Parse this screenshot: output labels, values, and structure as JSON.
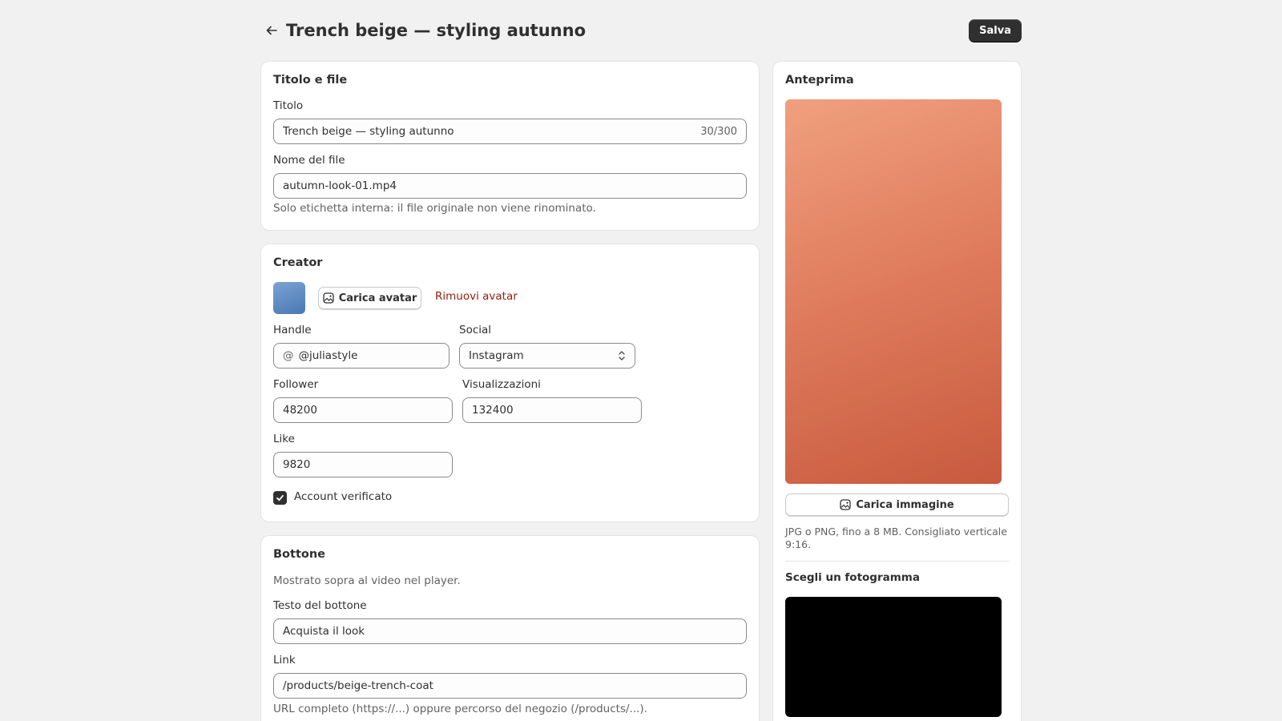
{
  "header": {
    "title": "Trench beige — styling autunno",
    "save_label": "Salva"
  },
  "title_card": {
    "heading": "Titolo e file",
    "title_label": "Titolo",
    "title_value": "Trench beige — styling autunno",
    "title_counter": "30/300",
    "filename_label": "Nome del file",
    "filename_value": "autumn-look-01.mp4",
    "filename_help": "Solo etichetta interna: il file originale non viene rinominato."
  },
  "creator_card": {
    "heading": "Creator",
    "upload_avatar_label": "Carica avatar",
    "remove_avatar_label": "Rimuovi avatar",
    "handle_label": "Handle",
    "handle_prefix": "@",
    "handle_value": "@juliastyle",
    "social_label": "Social",
    "social_value": "Instagram",
    "followers_label": "Follower",
    "followers_value": "48200",
    "views_label": "Visualizzazioni",
    "views_value": "132400",
    "likes_label": "Like",
    "likes_value": "9820",
    "verified_label": "Account verificato",
    "verified_checked": true
  },
  "button_card": {
    "heading": "Bottone",
    "description": "Mostrato sopra al video nel player.",
    "text_label": "Testo del bottone",
    "text_value": "Acquista il look",
    "link_label": "Link",
    "link_value": "/products/beige-trench-coat",
    "link_help": "URL completo (https://...) oppure percorso del negozio (/products/...)."
  },
  "preview_card": {
    "heading": "Anteprima",
    "upload_image_label": "Carica immagine",
    "upload_help": "JPG o PNG, fino a 8 MB. Consigliato verticale 9:16.",
    "frame_heading": "Scegli un fotogramma"
  },
  "colors": {
    "preview_gradient_start": "#f0a07e",
    "preview_gradient_end": "#c85a3e",
    "avatar_start": "#7ba3d6",
    "avatar_end": "#4a78b0",
    "danger_link": "#8e1f0b"
  }
}
